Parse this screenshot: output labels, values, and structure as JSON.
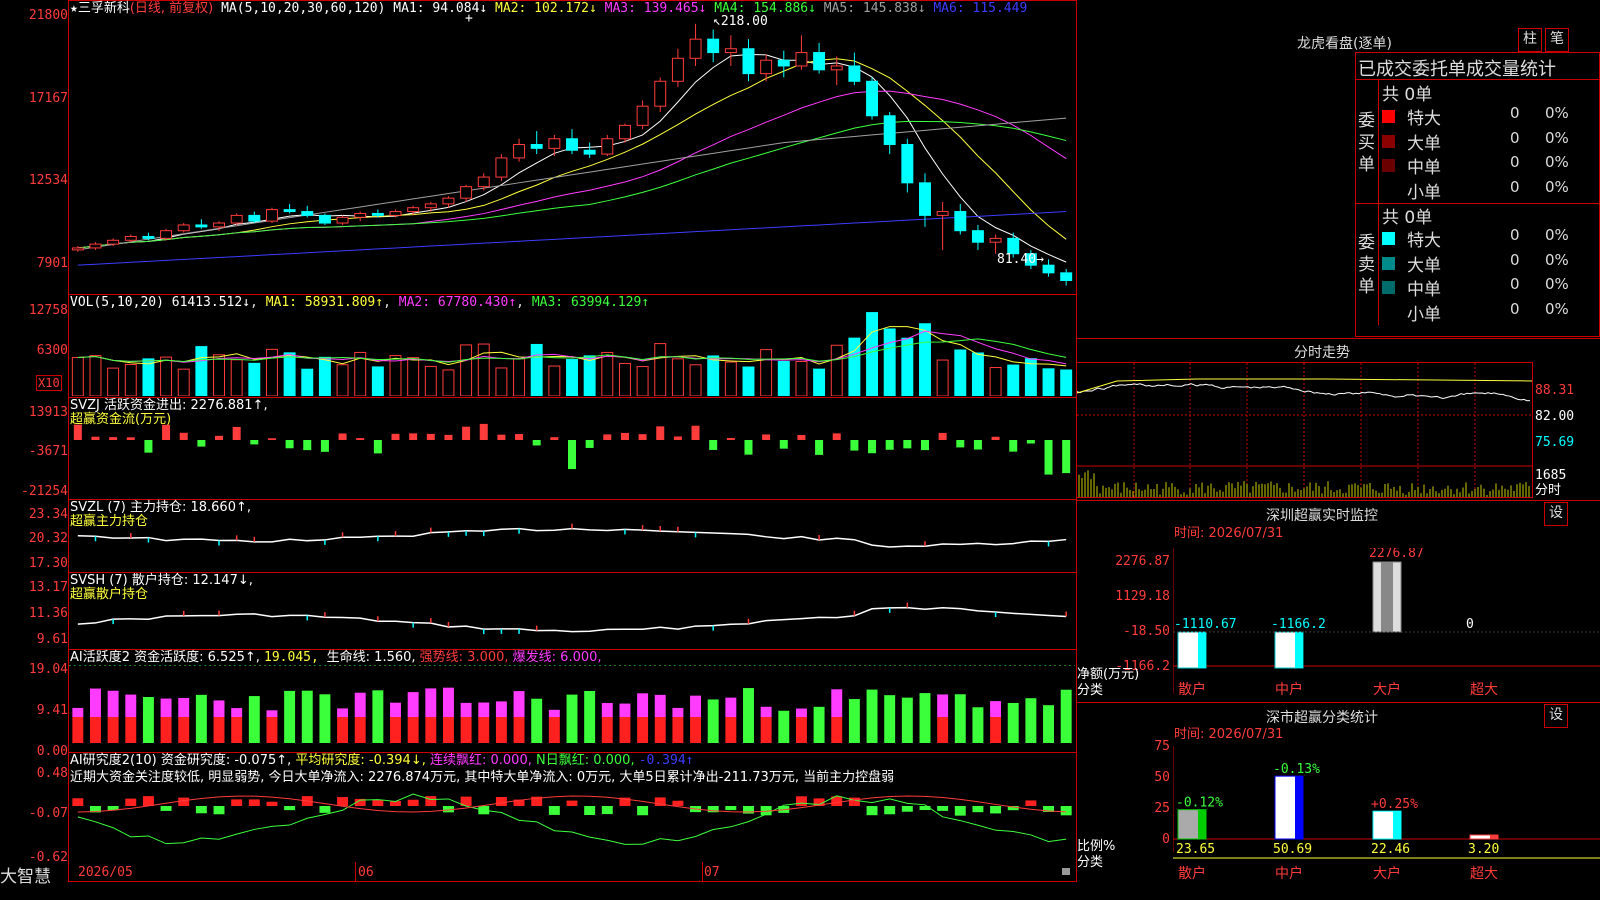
{
  "stock": {
    "name": "三孚新科",
    "mode": "(日线, 前复权)",
    "ma_label": "MA(5,10,20,30,60,120)",
    "ma1": "MA1: 94.084↓",
    "ma2": "MA2: 102.172↓",
    "ma3": "MA3: 139.465↓",
    "ma4": "MA4: 154.886↓",
    "ma5": "MA5: 145.838↓",
    "ma6": "MA6: 115.449",
    "high_marker": "218.00",
    "low_marker": "81.40"
  },
  "price_axis": [
    "21800",
    "17167",
    "12534",
    "7901"
  ],
  "vol": {
    "label": "VOL(5,10,20)",
    "val": "61413.512↓",
    "ma1": "MA1: 58931.809↑",
    "ma2": "MA2: 67780.430↑",
    "ma3": "MA3: 63994.129↑",
    "axis": [
      "12758",
      "6300"
    ],
    "unit": "X10"
  },
  "svzj": {
    "line1": "SVZJ  活跃资金进出: 2276.881↑,",
    "line2": "超赢资金流(万元)",
    "axis": [
      "13913",
      "-3671",
      "-21254"
    ]
  },
  "svzl": {
    "line1": "SVZL (7) 主力持仓: 18.660↑,",
    "line2": "超赢主力持仓",
    "axis": [
      "23.34",
      "20.32",
      "17.30"
    ]
  },
  "svsh": {
    "line1": "SVSH (7) 散户持仓: 12.147↓,",
    "line2": "超赢散户持仓",
    "axis": [
      "13.17",
      "11.36",
      "9.61"
    ]
  },
  "ai": {
    "prefix": "AI活跃度2 资金活跃度: 6.525↑, ",
    "v2": "19.045, ",
    "v3": "生命线: 1.560, ",
    "v4": "强势线: 3.000, ",
    "v5": "爆发线: 6.000,",
    "axis": [
      "19.04",
      "9.41",
      "0.00"
    ]
  },
  "ai2": {
    "prefix": "AI研究度2(10) 资金研究度: -0.075↑, ",
    "avg": "平均研究度: -0.394↓, ",
    "lh": "连续飘红: 0.000, ",
    "nr": "N日飘红: 0.000, ",
    "v5": "-0.394↑",
    "comment": "近期大资金关注度较低, 明显弱势, 今日大单净流入: 2276.874万元, 其中特大单净流入: 0万元, 大单5日累计净出-211.73万元, 当前主力控盘弱",
    "axis": [
      "0.48",
      "-0.07",
      "-0.62"
    ]
  },
  "bottom": {
    "brand": "大智慧",
    "dates": [
      "2026/05",
      "06",
      "07"
    ]
  },
  "dragon": {
    "title": "龙虎看盘(逐单)",
    "btn1": "柱",
    "btn2": "笔",
    "header": "已成交委托单成交量统计",
    "buy_label": "委买单",
    "sell_label": "委卖单",
    "buy_total": "共 0单",
    "sell_total": "共 0单",
    "rows": [
      "特大",
      "大单",
      "中单",
      "小单"
    ],
    "zero": "0",
    "pct": "0%",
    "buy_colors": [
      "#ff0000",
      "#8b0000",
      "#6b0000",
      "#000000"
    ],
    "sell_colors": [
      "#00ffff",
      "#008b8b",
      "#006b6b",
      "#000000"
    ]
  },
  "intraday": {
    "title": "分时走势",
    "axis": [
      "88.31",
      "82.00",
      "75.69",
      "1685",
      "分时"
    ]
  },
  "monitor": {
    "title": "深圳超赢实时监控",
    "set": "设",
    "time": "时间: 2026/07/31",
    "axis": [
      "2276.87",
      "1129.18",
      "-18.50",
      "-1166.2"
    ],
    "ylabel": "净额(万元)",
    "xlabel": "分类",
    "cats": [
      "散户",
      "中户",
      "大户",
      "超大"
    ],
    "values": [
      "-1110.67",
      "-1166.2",
      "2276.87",
      "0"
    ]
  },
  "classify": {
    "title": "深市超赢分类统计",
    "set": "设",
    "time": "时间: 2026/07/31",
    "axis": [
      "75",
      "50",
      "25",
      "0"
    ],
    "ylabel": "比例%",
    "xlabel": "分类",
    "cats": [
      "散户",
      "中户",
      "大户",
      "超大"
    ],
    "values": [
      "23.65",
      "50.69",
      "22.46",
      "3.20"
    ],
    "deltas": [
      "-0.12%",
      "-0.13%",
      "+0.25%",
      ""
    ]
  },
  "chart_data": {
    "type": "candlestick",
    "y_range": [
      7901,
      21800
    ],
    "ohlc": [
      [
        100,
        102,
        99,
        101
      ],
      [
        101,
        104,
        100,
        103
      ],
      [
        103,
        106,
        102,
        105
      ],
      [
        105,
        108,
        104,
        107
      ],
      [
        107,
        109,
        105,
        106
      ],
      [
        106,
        111,
        105,
        110
      ],
      [
        110,
        114,
        109,
        113
      ],
      [
        113,
        116,
        111,
        112
      ],
      [
        112,
        115,
        110,
        114
      ],
      [
        114,
        119,
        113,
        118
      ],
      [
        118,
        120,
        114,
        115
      ],
      [
        115,
        122,
        114,
        121
      ],
      [
        121,
        124,
        119,
        120
      ],
      [
        120,
        123,
        117,
        118
      ],
      [
        118,
        119,
        113,
        114
      ],
      [
        114,
        118,
        113,
        117
      ],
      [
        117,
        120,
        115,
        119
      ],
      [
        119,
        121,
        117,
        118
      ],
      [
        118,
        121,
        117,
        120
      ],
      [
        120,
        123,
        118,
        122
      ],
      [
        122,
        125,
        120,
        124
      ],
      [
        124,
        128,
        122,
        127
      ],
      [
        127,
        134,
        125,
        133
      ],
      [
        133,
        140,
        131,
        138
      ],
      [
        138,
        150,
        136,
        148
      ],
      [
        148,
        158,
        146,
        155
      ],
      [
        155,
        162,
        150,
        153
      ],
      [
        153,
        160,
        149,
        158
      ],
      [
        158,
        163,
        150,
        152
      ],
      [
        152,
        156,
        148,
        150
      ],
      [
        150,
        160,
        149,
        158
      ],
      [
        158,
        166,
        156,
        165
      ],
      [
        165,
        178,
        163,
        175
      ],
      [
        175,
        190,
        172,
        188
      ],
      [
        188,
        205,
        185,
        200
      ],
      [
        200,
        218,
        196,
        210
      ],
      [
        210,
        215,
        198,
        203
      ],
      [
        203,
        212,
        196,
        205
      ],
      [
        205,
        210,
        188,
        192
      ],
      [
        192,
        202,
        188,
        199
      ],
      [
        199,
        204,
        190,
        196
      ],
      [
        196,
        212,
        194,
        203
      ],
      [
        203,
        208,
        192,
        194
      ],
      [
        194,
        201,
        186,
        196
      ],
      [
        196,
        203,
        186,
        188
      ],
      [
        188,
        190,
        168,
        170
      ],
      [
        170,
        172,
        150,
        155
      ],
      [
        155,
        158,
        130,
        135
      ],
      [
        135,
        140,
        112,
        118
      ],
      [
        118,
        125,
        100,
        120
      ],
      [
        120,
        124,
        108,
        110
      ],
      [
        110,
        113,
        100,
        104
      ],
      [
        104,
        108,
        98,
        106
      ],
      [
        106,
        109,
        96,
        98
      ],
      [
        98,
        100,
        90,
        92
      ],
      [
        92,
        95,
        86,
        88
      ],
      [
        88,
        90,
        81.4,
        84
      ]
    ]
  }
}
